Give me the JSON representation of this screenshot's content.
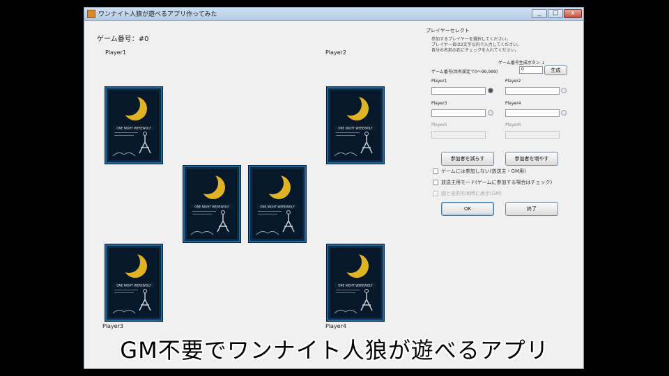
{
  "window": {
    "title": "ワンナイト人狼が遊べるアプリ作ってみた",
    "buttons": {
      "minimize": "_",
      "maximize": "□",
      "close": "x"
    }
  },
  "game": {
    "number_label": "ゲーム番号：#0"
  },
  "players": {
    "p1": "Player1",
    "p2": "Player2",
    "p3": "Player3",
    "p4": "Player4"
  },
  "card": {
    "caption": "ONE NIGHT WEREWOLF"
  },
  "panel": {
    "header": "プレイヤーセレクト",
    "instructions": [
      "参加するプレイヤーを選択してください。",
      "プレイヤー名は2文字以内で入力してください。",
      "自分の名前の右にチェックを入れてください。"
    ],
    "gen_key_label": "ゲーム番号生成ボタン ↓",
    "game_num_label": "ゲーム番号(共有設定で0～99,999)",
    "game_num_value": "0",
    "generate_button": "生成",
    "fields": [
      {
        "label": "Player1",
        "value": ""
      },
      {
        "label": "Player2",
        "value": ""
      },
      {
        "label": "Player3",
        "value": ""
      },
      {
        "label": "Player4",
        "value": ""
      },
      {
        "label": "Player5",
        "value": ""
      },
      {
        "label": "Player6",
        "value": ""
      }
    ],
    "remove_button": "参加者を減らす",
    "add_button": "参加者を増やす",
    "checkboxes": [
      "ゲームには参加しない(放送主・GM用)",
      "放送主用モード(ゲームに参加する場合はチェック)",
      "図と役割を同時に表示(GM)"
    ],
    "ok_button": "OK",
    "exit_button": "終了"
  },
  "subtitle": "GM不要でワンナイト人狼が遊べるアプリ",
  "colors": {
    "card_bg": "#0b2b46",
    "card_border": "#1b6aa0",
    "moon": "#e0b325"
  }
}
